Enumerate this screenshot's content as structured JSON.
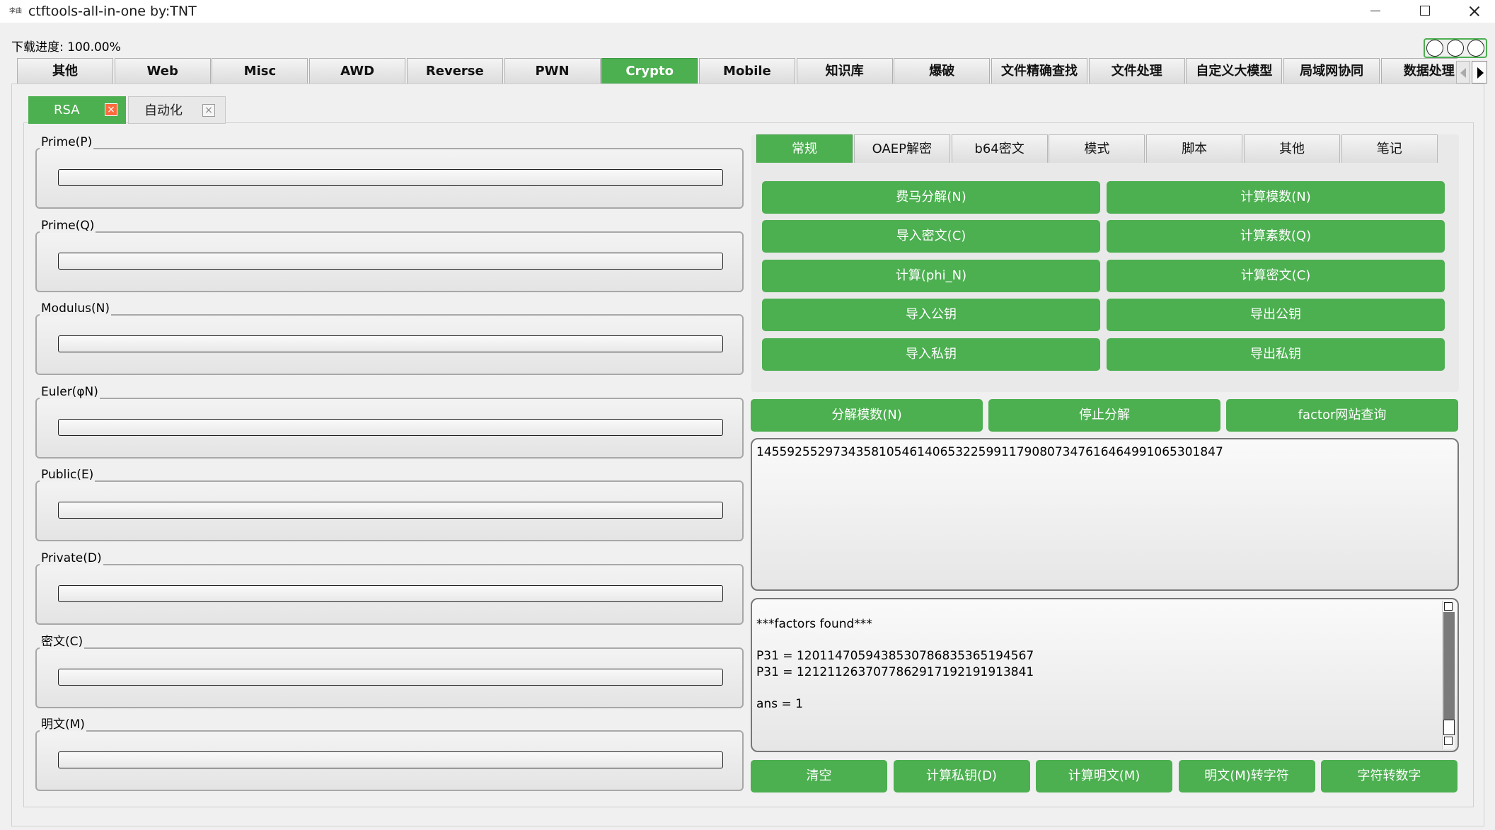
{
  "window": {
    "icon_text": "李曲",
    "title": "ctftools-all-in-one   by:TNT"
  },
  "status": {
    "progress": "下载进度: 100.00%"
  },
  "main_tabs": [
    "其他",
    "Web",
    "Misc",
    "AWD",
    "Reverse",
    "PWN",
    "Crypto",
    "Mobile",
    "知识库",
    "爆破",
    "文件精确查找",
    "文件处理",
    "自定义大模型",
    "局域网协同",
    "数据处理"
  ],
  "active_main_tab": "Crypto",
  "sub_tabs": [
    {
      "label": "RSA",
      "close": "×"
    },
    {
      "label": "自动化",
      "close": "×"
    }
  ],
  "fields": [
    {
      "label": "Prime(P)",
      "value": ""
    },
    {
      "label": "Prime(Q)",
      "value": ""
    },
    {
      "label": "Modulus(N)",
      "value": ""
    },
    {
      "label": "Euler(φN)",
      "value": ""
    },
    {
      "label": "Public(E)",
      "value": ""
    },
    {
      "label": "Private(D)",
      "value": ""
    },
    {
      "label": "密文(C)",
      "value": ""
    },
    {
      "label": "明文(M)",
      "value": ""
    }
  ],
  "right_tabs": [
    "常规",
    "OAEP解密",
    "b64密文",
    "模式",
    "脚本",
    "其他",
    "笔记"
  ],
  "active_right_tab": "常规",
  "grid_buttons": [
    [
      "费马分解(N)",
      "计算模数(N)"
    ],
    [
      "导入密文(C)",
      "计算素数(Q)"
    ],
    [
      "计算(phi_N)",
      "计算密文(C)"
    ],
    [
      "导入公钥",
      "导出公钥"
    ],
    [
      "导入私钥",
      "导出私钥"
    ]
  ],
  "factor_buttons": [
    "分解模数(N)",
    "停止分解",
    "factor网站查询"
  ],
  "modulus_text": "1455925529734358105461406532259911790807347616464991065301847",
  "output_text": "***factors found***\n\nP31 = 1201147059438530786835365194567\nP31 = 1212112637077862917192191913841\n\nans = 1",
  "bottom_buttons": [
    "清空",
    "计算私钥(D)",
    "计算明文(M)",
    "明文(M)转字符",
    "字符转数字"
  ],
  "colors": {
    "accent_green": "#4caf50",
    "close_orange": "#ff6a3d"
  }
}
